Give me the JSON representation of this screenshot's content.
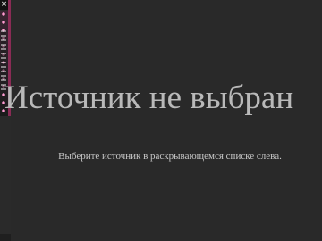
{
  "side_strip": {
    "close_glyph": "×"
  },
  "main": {
    "heading": "Источник не выбран",
    "message": "Выберите источник в раскрывающемся списке слева."
  },
  "colors": {
    "background": "#292929",
    "heading_text": "#b9b9b9",
    "message_text": "#c8c8c8",
    "strip_accent": "#8a2b55"
  }
}
